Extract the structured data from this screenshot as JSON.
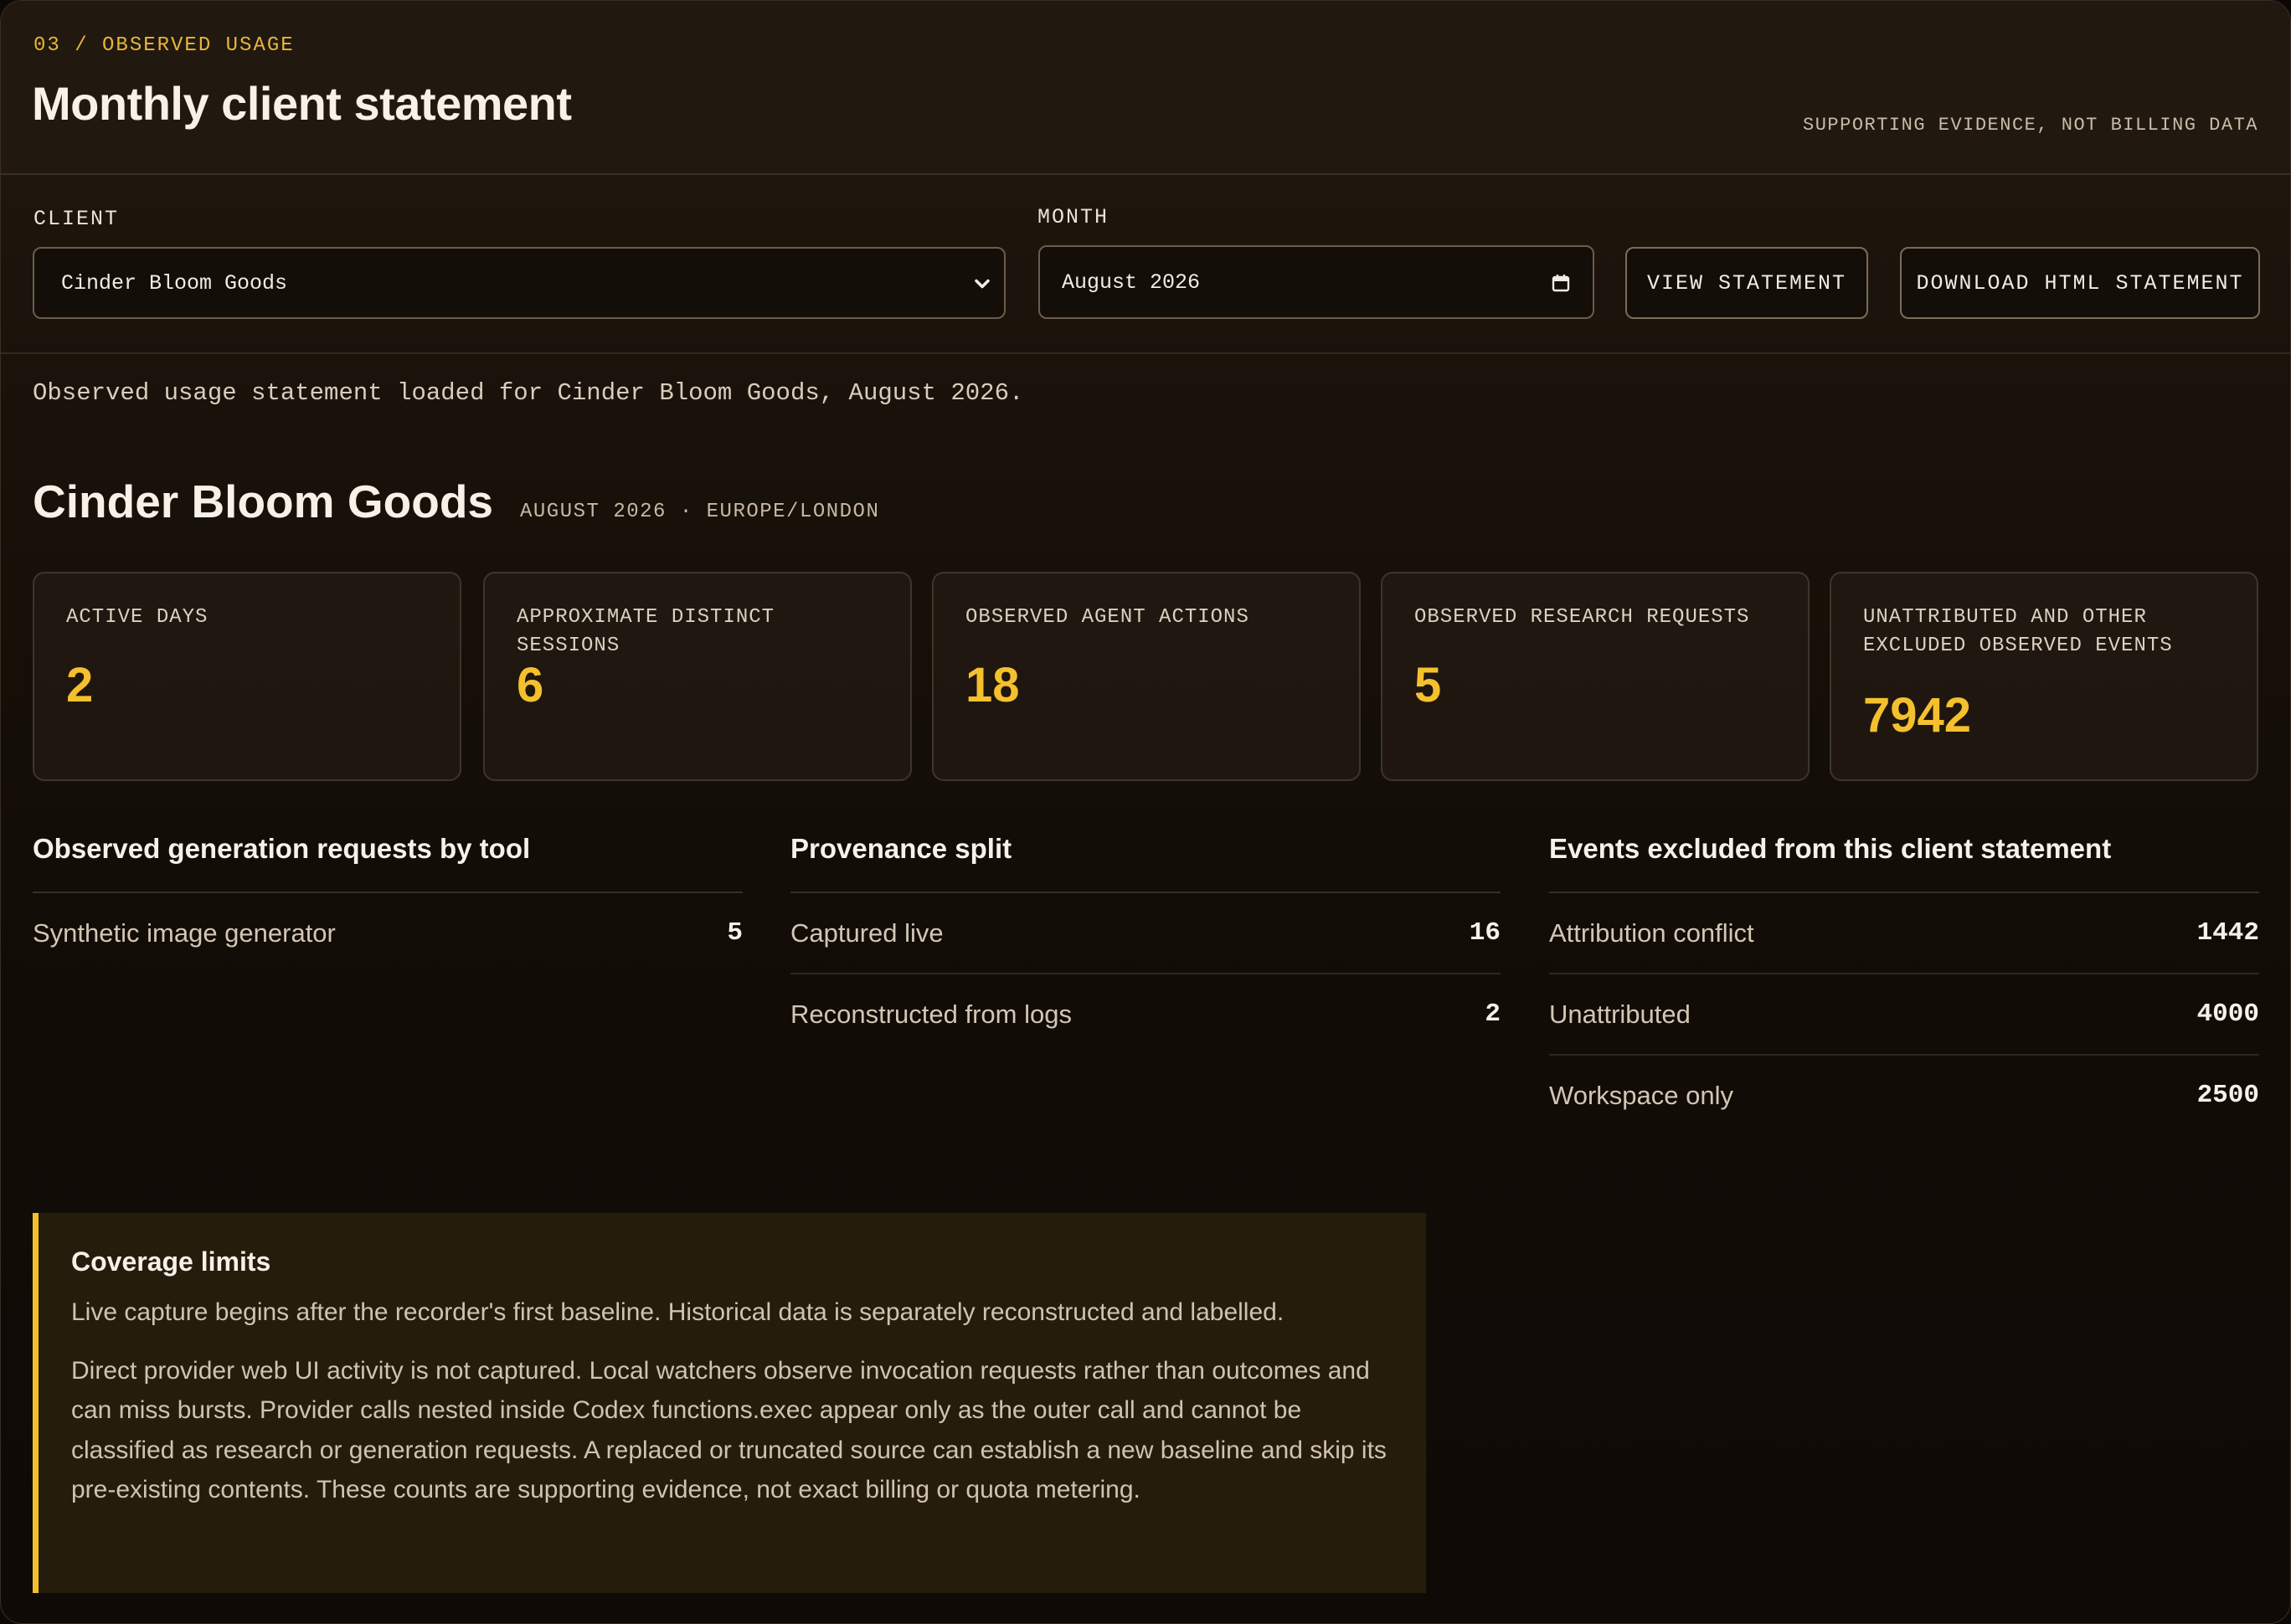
{
  "header": {
    "eyebrow": "03 / OBSERVED USAGE",
    "title": "Monthly client statement",
    "note": "SUPPORTING EVIDENCE, NOT BILLING DATA"
  },
  "controls": {
    "client_label": "CLIENT",
    "client_value": "Cinder Bloom Goods",
    "month_label": "MONTH",
    "month_value": "August 2026",
    "view_button": "VIEW STATEMENT",
    "download_button": "DOWNLOAD HTML STATEMENT"
  },
  "status": "Observed usage statement loaded for Cinder Bloom Goods, August 2026.",
  "client": {
    "name": "Cinder Bloom Goods",
    "meta": "AUGUST 2026 · EUROPE/LONDON"
  },
  "metrics": [
    {
      "label": "ACTIVE DAYS",
      "value": "2"
    },
    {
      "label": "APPROXIMATE DISTINCT SESSIONS",
      "value": "6"
    },
    {
      "label": "OBSERVED AGENT ACTIONS",
      "value": "18"
    },
    {
      "label": "OBSERVED RESEARCH REQUESTS",
      "value": "5"
    },
    {
      "label": "UNATTRIBUTED AND OTHER EXCLUDED OBSERVED EVENTS",
      "value": "7942"
    }
  ],
  "tools": {
    "title": "Observed generation requests by tool",
    "rows": [
      {
        "label": "Synthetic image generator",
        "value": "5"
      }
    ]
  },
  "provenance": {
    "title": "Provenance split",
    "rows": [
      {
        "label": "Captured live",
        "value": "16"
      },
      {
        "label": "Reconstructed from logs",
        "value": "2"
      }
    ]
  },
  "excluded": {
    "title": "Events excluded from this client statement",
    "rows": [
      {
        "label": "Attribution conflict",
        "value": "1442"
      },
      {
        "label": "Unattributed",
        "value": "4000"
      },
      {
        "label": "Workspace only",
        "value": "2500"
      }
    ]
  },
  "coverage": {
    "title": "Coverage limits",
    "paragraph1": "Live capture begins after the recorder's first baseline. Historical data is separately reconstructed and labelled.",
    "paragraph2": "Direct provider web UI activity is not captured. Local watchers observe invocation requests rather than outcomes and can miss bursts. Provider calls nested inside Codex functions.exec appear only as the outer call and cannot be classified as research or generation requests. A replaced or truncated source can establish a new baseline and skip its pre-existing contents. These counts are supporting evidence, not exact billing or quota metering."
  },
  "colors": {
    "accent": "#f5c02e",
    "background": "#140e08",
    "coverage_bar": "#f2bf2a"
  }
}
